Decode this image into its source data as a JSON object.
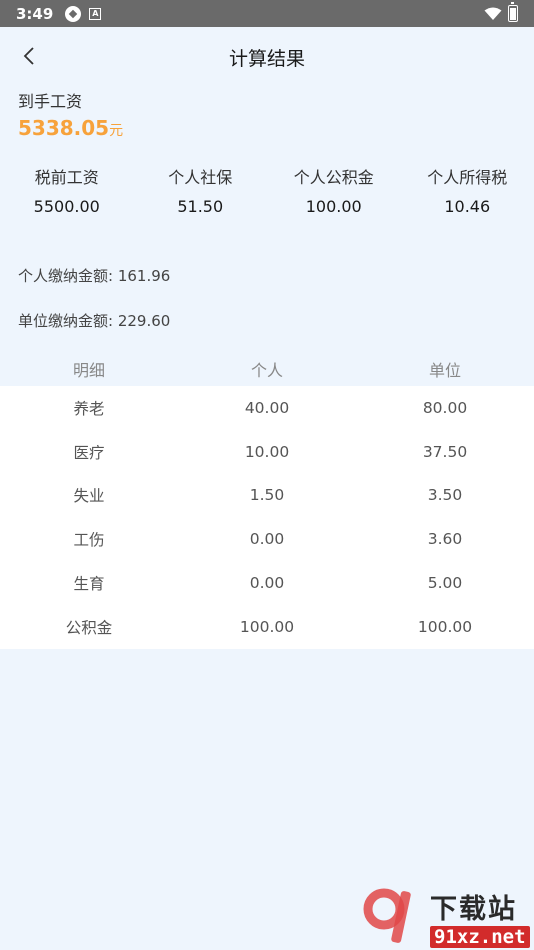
{
  "status_bar": {
    "time": "3:49"
  },
  "header": {
    "title": "计算结果"
  },
  "net_salary": {
    "label": "到手工资",
    "value": "5338.05",
    "unit": "元"
  },
  "summary": [
    {
      "label": "税前工资",
      "value": "5500.00"
    },
    {
      "label": "个人社保",
      "value": "51.50"
    },
    {
      "label": "个人公积金",
      "value": "100.00"
    },
    {
      "label": "个人所得税",
      "value": "10.46"
    }
  ],
  "totals": {
    "personal": "个人缴纳金额: 161.96",
    "company": "单位缴纳金额: 229.60"
  },
  "detail_table": {
    "headers": [
      "明细",
      "个人",
      "单位"
    ],
    "rows": [
      [
        "养老",
        "40.00",
        "80.00"
      ],
      [
        "医疗",
        "10.00",
        "37.50"
      ],
      [
        "失业",
        "1.50",
        "3.50"
      ],
      [
        "工伤",
        "0.00",
        "3.60"
      ],
      [
        "生育",
        "0.00",
        "5.00"
      ],
      [
        "公积金",
        "100.00",
        "100.00"
      ]
    ]
  },
  "watermark": {
    "title": "下载站",
    "url": "91xz.net"
  },
  "colors": {
    "background": "#eef5fd",
    "accent_orange": "#f7a23b",
    "watermark_red": "#d22b2b"
  }
}
